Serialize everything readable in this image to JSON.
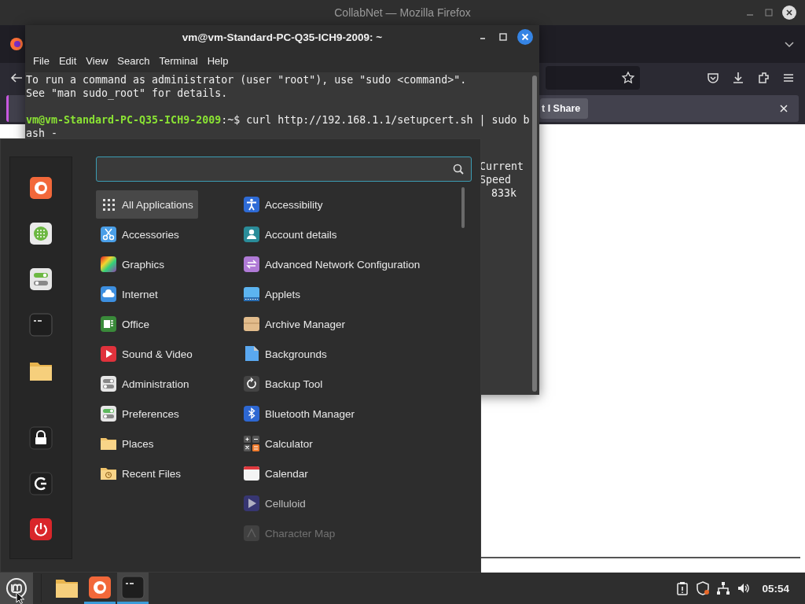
{
  "firefox": {
    "title": "CollabNet — Mozilla Firefox",
    "notification_button": "t I Share"
  },
  "terminal": {
    "title": "vm@vm-Standard-PC-Q35-ICH9-2009: ~",
    "menu": [
      "File",
      "Edit",
      "View",
      "Search",
      "Terminal",
      "Help"
    ],
    "lines": [
      "To run a command as administrator (user \"root\"), use \"sudo <command>\".",
      "See \"man sudo_root\" for details."
    ],
    "prompt": {
      "user": "vm@vm-Standard-PC-Q35-ICH9-2009",
      "symbol": ":~$",
      "command": "curl http://192.168.1.1/setupcert.sh | sudo b"
    },
    "continuation": "ash -",
    "progress": [
      "Current",
      "Speed",
      "833k"
    ]
  },
  "menu": {
    "favorites": [
      {
        "kind": "firefox"
      },
      {
        "kind": "software"
      },
      {
        "kind": "settings"
      },
      {
        "kind": "terminal"
      },
      {
        "kind": "files"
      }
    ],
    "session": [
      {
        "kind": "lock"
      },
      {
        "kind": "logout"
      },
      {
        "kind": "power"
      }
    ],
    "categories": [
      {
        "label": "All Applications",
        "kind": "grid",
        "selected": true
      },
      {
        "label": "Accessories",
        "kind": "accessories",
        "selected": false
      },
      {
        "label": "Graphics",
        "kind": "graphics",
        "selected": false
      },
      {
        "label": "Internet",
        "kind": "internet",
        "selected": false
      },
      {
        "label": "Office",
        "kind": "office",
        "selected": false
      },
      {
        "label": "Sound & Video",
        "kind": "video",
        "selected": false
      },
      {
        "label": "Administration",
        "kind": "admin",
        "selected": false
      },
      {
        "label": "Preferences",
        "kind": "prefs",
        "selected": false
      },
      {
        "label": "Places",
        "kind": "folder",
        "selected": false
      },
      {
        "label": "Recent Files",
        "kind": "recent",
        "selected": false
      }
    ],
    "applications": [
      {
        "label": "Accessibility",
        "kind": "accessibility"
      },
      {
        "label": "Account details",
        "kind": "account"
      },
      {
        "label": "Advanced Network Configuration",
        "kind": "network"
      },
      {
        "label": "Applets",
        "kind": "applets"
      },
      {
        "label": "Archive Manager",
        "kind": "archive"
      },
      {
        "label": "Backgrounds",
        "kind": "backgrounds"
      },
      {
        "label": "Backup Tool",
        "kind": "backup"
      },
      {
        "label": "Bluetooth Manager",
        "kind": "bluetooth"
      },
      {
        "label": "Calculator",
        "kind": "calculator"
      },
      {
        "label": "Calendar",
        "kind": "calendar"
      },
      {
        "label": "Celluloid",
        "kind": "celluloid"
      },
      {
        "label": "Character Map",
        "kind": "charmap"
      }
    ]
  },
  "taskbar": {
    "menu_button": {
      "selected": true
    },
    "apps": [
      {
        "kind": "files",
        "running": false,
        "selected": false
      },
      {
        "kind": "firefox",
        "running": true,
        "selected": false
      },
      {
        "kind": "terminal",
        "running": true,
        "selected": true
      }
    ],
    "clock": "05:54"
  }
}
